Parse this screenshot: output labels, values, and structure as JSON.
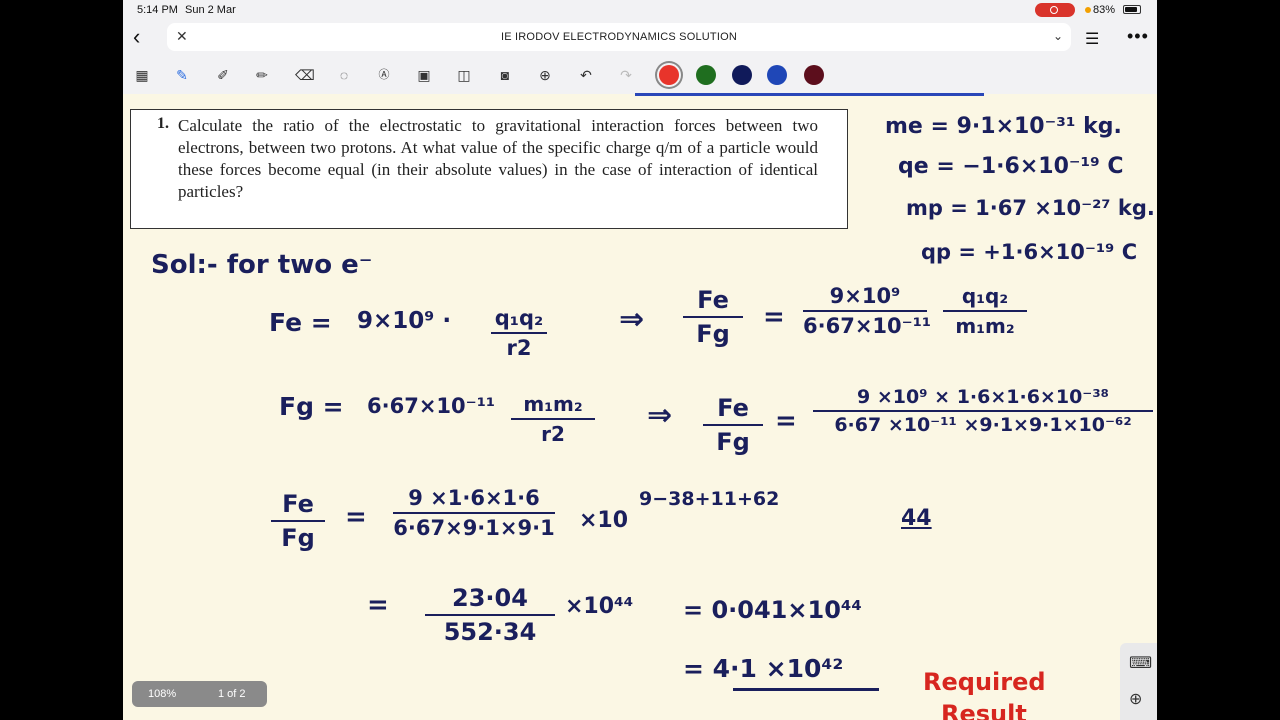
{
  "status_bar": {
    "time": "5:14 PM",
    "date": "Sun 2 Mar",
    "battery": "83%"
  },
  "browser": {
    "title": "IE IRODOV ELECTRODYNAMICS SOLUTION"
  },
  "toolbar": {
    "tools": [
      "grid-icon",
      "pen-icon",
      "highlighter-icon",
      "marker-icon",
      "eraser-icon",
      "lasso-icon",
      "text-box-icon",
      "image-icon",
      "shapes-icon",
      "camera-icon",
      "add-icon",
      "undo-icon",
      "redo-icon"
    ],
    "colors": [
      "#e8342b",
      "#1f6e1f",
      "#101a5a",
      "#1f47b7",
      "#5c0e1c"
    ]
  },
  "question": {
    "number": "1.",
    "text": "Calculate the ratio of the electrostatic to gravitational interaction forces between two electrons, between two protons. At what value of the specific charge q/m of a particle would these forces become equal (in their absolute values) in the case of interaction of identical particles?"
  },
  "notes": {
    "me": "me = 9·1×10⁻³¹ kg.",
    "qe": "qe = −1·6×10⁻¹⁹ C",
    "mp": "mp = 1·67 ×10⁻²⁷ kg.",
    "qp": "qp = +1·6×10⁻¹⁹ C",
    "sol": "Sol:- for two e⁻",
    "fe_lhs": "Fe =",
    "fe_coef": "9×10⁹ ·",
    "fe_num": "q₁q₂",
    "fe_den": "r2",
    "arrow1": "⇒",
    "ratio1_num": "Fe",
    "ratio1_den": "Fg",
    "eq1": "=",
    "r1_num": "9×10⁹",
    "r1_den": "6·67×10⁻¹¹",
    "r1b_num": "q₁q₂",
    "r1b_den": "m₁m₂",
    "fg_lhs": "Fg =",
    "fg_coef": "6·67×10⁻¹¹",
    "fg_num": "m₁m₂",
    "fg_den": "r2",
    "arrow2": "⇒",
    "ratio2_num": "Fe",
    "ratio2_den": "Fg",
    "eq2": "=",
    "r2_num": "9 ×10⁹ × 1·6×1·6×10⁻³⁸",
    "r2_den": "6·67 ×10⁻¹¹ ×9·1×9·1×10⁻⁶²",
    "ratio3_num": "Fe",
    "ratio3_den": "Fg",
    "eq3": "=",
    "r3_num": "9 ×1·6×1·6",
    "r3_den": "6·67×9·1×9·1",
    "r3_mult": "×10",
    "r3_exp": "9−38+11+62",
    "side_44": "44",
    "eq4": "=",
    "r4_num": "23·04",
    "r4_den": "552·34",
    "r4_mult": "×10⁴⁴",
    "r4_result": "= 0·041×10⁴⁴",
    "r5_result": "= 4·1 ×10⁴²",
    "required": "Required",
    "result": "Result"
  },
  "viewer": {
    "zoom": "108%",
    "page": "1 of 2"
  }
}
